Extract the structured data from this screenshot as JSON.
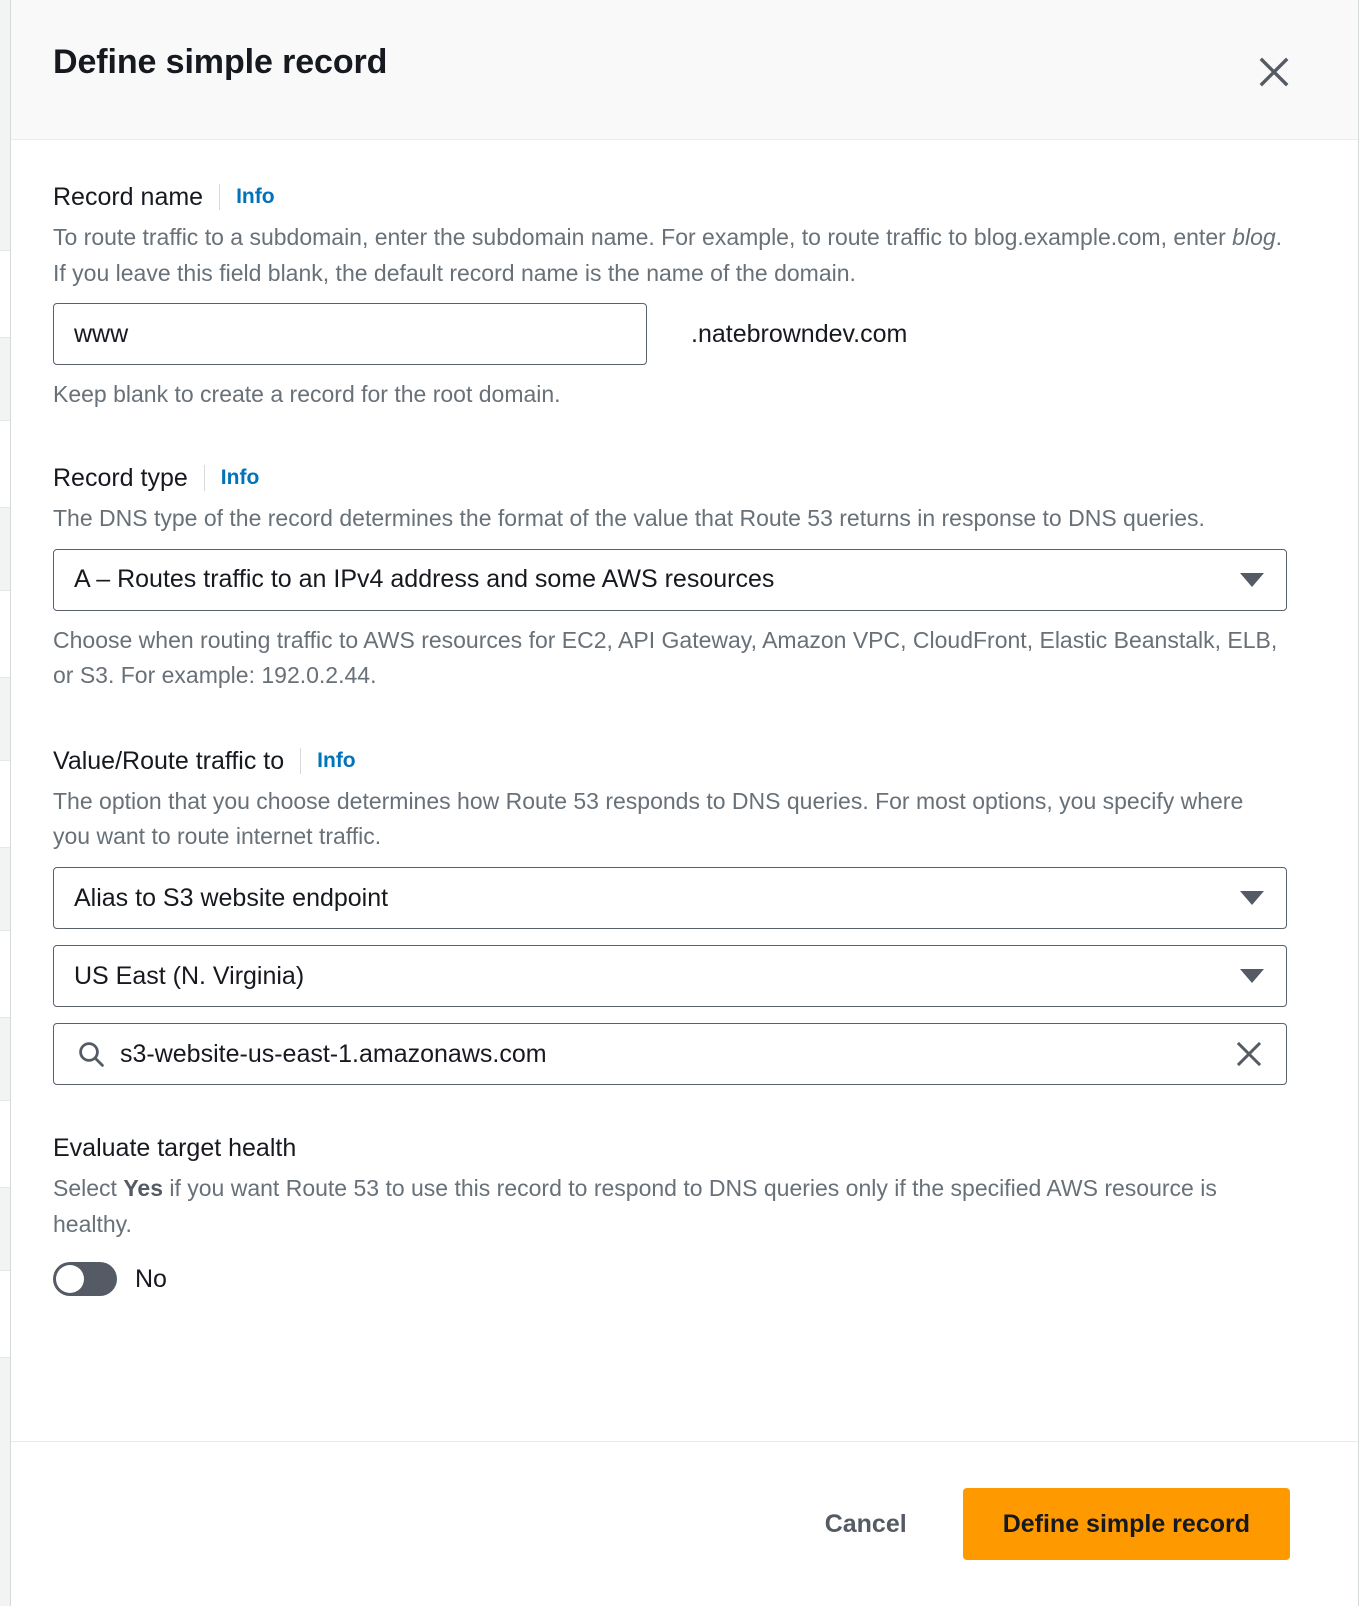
{
  "header": {
    "title": "Define simple record",
    "close_icon": "close-icon"
  },
  "record_name": {
    "label": "Record name",
    "info_label": "Info",
    "description_part1": "To route traffic to a subdomain, enter the subdomain name. For example, to route traffic to blog.example.com, enter ",
    "description_emphasis": "blog",
    "description_part2": ". If you leave this field blank, the default record name is the name of the domain.",
    "input_value": "www",
    "input_placeholder": "",
    "domain_suffix": ".natebrowndev.com",
    "hint": "Keep blank to create a record for the root domain."
  },
  "record_type": {
    "label": "Record type",
    "info_label": "Info",
    "description": "The DNS type of the record determines the format of the value that Route 53 returns in response to DNS queries.",
    "selected": "A – Routes traffic to an IPv4 address and some AWS resources",
    "hint": "Choose when routing traffic to AWS resources for EC2, API Gateway, Amazon VPC, CloudFront, Elastic Beanstalk, ELB, or S3. For example: 192.0.2.44."
  },
  "value_route": {
    "label": "Value/Route traffic to",
    "info_label": "Info",
    "description": "The option that you choose determines how Route 53 responds to DNS queries. For most options, you specify where you want to route internet traffic.",
    "alias_target": "Alias to S3 website endpoint",
    "region": "US East (N. Virginia)",
    "endpoint_value": "s3-website-us-east-1.amazonaws.com",
    "endpoint_placeholder": "Choose endpoint",
    "search_icon": "search-icon",
    "clear_icon": "close-icon"
  },
  "evaluate_target_health": {
    "label": "Evaluate target health",
    "description_part1": "Select ",
    "description_emphasis": "Yes",
    "description_part2": " if you want Route 53 to use this record to respond to DNS queries only if the specified AWS resource is healthy.",
    "toggle_state": "No"
  },
  "footer": {
    "cancel_label": "Cancel",
    "submit_label": "Define simple record"
  },
  "colors": {
    "accent_orange": "#ff9900",
    "link_blue": "#0073bb",
    "border_slate": "#59616b",
    "text_primary": "#16191f",
    "text_secondary": "#687078",
    "header_bg": "#f9f9fa"
  }
}
